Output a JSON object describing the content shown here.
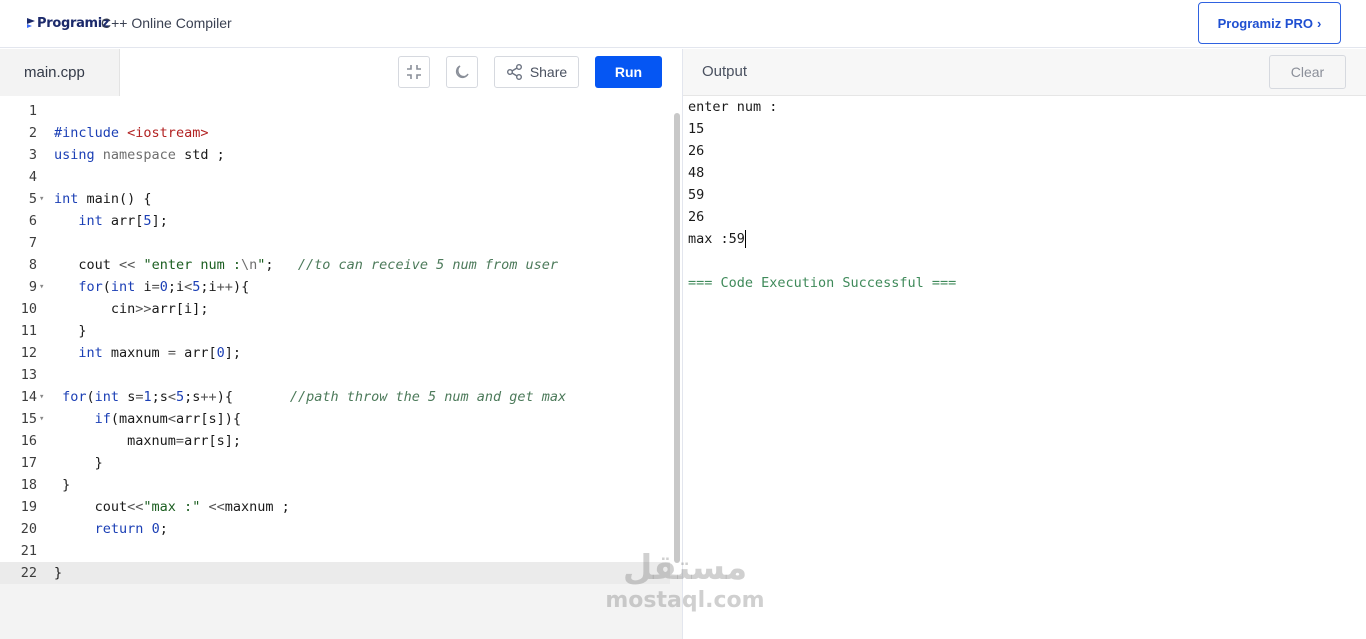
{
  "header": {
    "logo_text": "Programiz",
    "app_title": "C++ Online Compiler",
    "pro_button": "Programiz PRO",
    "brand_color": "#0556f3"
  },
  "editor": {
    "file_tab": "main.cpp",
    "share_label": "Share",
    "run_label": "Run",
    "lines": [
      {
        "n": "1",
        "html": ""
      },
      {
        "n": "2",
        "html": "<span class='inc'>#include</span> <span class='incpath'>&lt;iostream&gt;</span>"
      },
      {
        "n": "3",
        "html": "<span class='kw'>using</span> <span class='gray'>namespace</span> std ;"
      },
      {
        "n": "4",
        "html": ""
      },
      {
        "n": "5",
        "html": "<span class='type'>int</span> main() {",
        "fold": true
      },
      {
        "n": "6",
        "html": "   <span class='type'>int</span> arr[<span class='num'>5</span>];"
      },
      {
        "n": "7",
        "html": ""
      },
      {
        "n": "8",
        "html": "   cout <span class='op'>&lt;&lt;</span> <span class='str'>\"enter num :</span><span class='gray'>\\n</span><span class='str'>\"</span>;   <span class='cmt'>//to can receive 5 num from user</span>"
      },
      {
        "n": "9",
        "html": "   <span class='kw'>for</span>(<span class='type'>int</span> i<span class='op'>=</span><span class='num'>0</span>;i<span class='op'>&lt;</span><span class='num'>5</span>;i<span class='op'>++</span>){",
        "fold": true
      },
      {
        "n": "10",
        "html": "       cin<span class='op'>&gt;&gt;</span>arr[i];"
      },
      {
        "n": "11",
        "html": "   }"
      },
      {
        "n": "12",
        "html": "   <span class='type'>int</span> maxnum <span class='op'>=</span> arr[<span class='num'>0</span>];"
      },
      {
        "n": "13",
        "html": ""
      },
      {
        "n": "14",
        "html": " <span class='kw'>for</span>(<span class='type'>int</span> s<span class='op'>=</span><span class='num'>1</span>;s<span class='op'>&lt;</span><span class='num'>5</span>;s<span class='op'>++</span>){       <span class='cmt'>//path throw the 5 num and get max</span>",
        "fold": true
      },
      {
        "n": "15",
        "html": "     <span class='kw'>if</span>(maxnum<span class='op'>&lt;</span>arr[s]){",
        "fold": true
      },
      {
        "n": "16",
        "html": "         maxnum<span class='op'>=</span>arr[s];"
      },
      {
        "n": "17",
        "html": "     }"
      },
      {
        "n": "18",
        "html": " }"
      },
      {
        "n": "19",
        "html": "     cout<span class='op'>&lt;&lt;</span><span class='str'>\"max :\"</span> <span class='op'>&lt;&lt;</span>maxnum ;"
      },
      {
        "n": "20",
        "html": "     <span class='kw'>return</span> <span class='num'>0</span>;"
      },
      {
        "n": "21",
        "html": ""
      },
      {
        "n": "22",
        "html": "}",
        "active": true
      }
    ]
  },
  "output": {
    "title": "Output",
    "clear_label": "Clear",
    "lines": [
      "enter num :",
      "15",
      "26",
      "48",
      "59",
      "26",
      "max :59",
      ""
    ],
    "success": "=== Code Execution Successful ==="
  },
  "watermark": {
    "arabic": "مستقل",
    "latin": "mostaql.com"
  }
}
